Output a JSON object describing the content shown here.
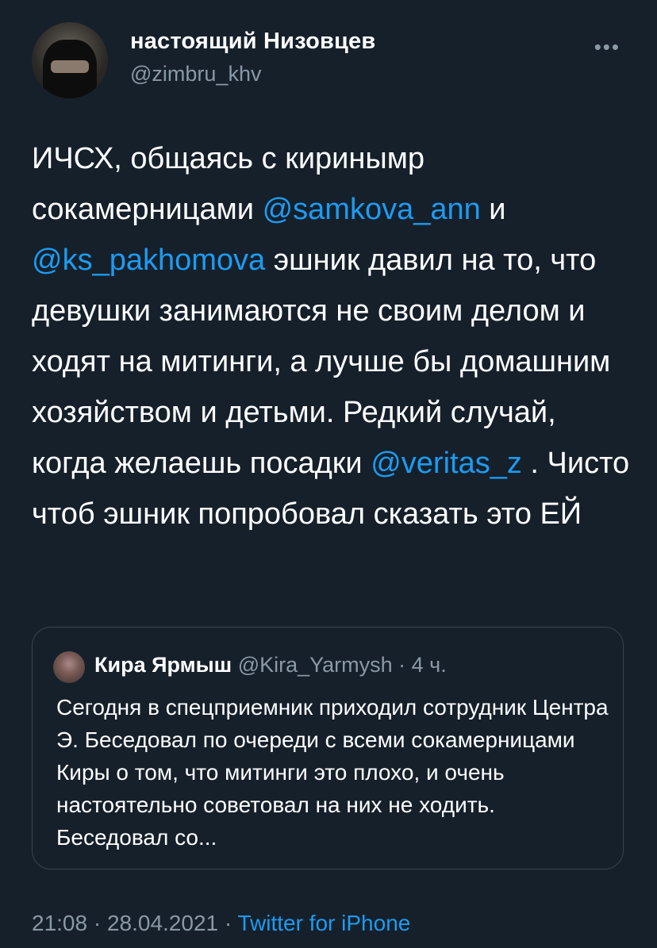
{
  "author": {
    "name": "настоящий Низовцев",
    "handle": "@zimbru_khv",
    "more_icon": "more-dots-icon"
  },
  "tweet": {
    "part1": "ИЧСХ, общаясь с киринымр сокамерницами ",
    "mention1": "@samkova_ann",
    "part2": " и ",
    "mention2": "@ks_pakhomova",
    "part3": " эшник давил на то, что девушки занимаются не своим делом и ходят на митинги, а лучше бы домашним хозяйством и детьми. Редкий случай, когда желаешь посадки ",
    "mention3": "@veritas_z",
    "part4": " . Чисто чтоб эшник попробовал сказать это ЕЙ"
  },
  "quoted": {
    "name": "Кира Ярмыш",
    "handle": "@Kira_Yarmysh",
    "time": "· 4 ч.",
    "text": "Сегодня в спецприемник приходил сотрудник Центра Э.  Беседовал по очереди с всеми сокамерницами Киры о том, что митинги это плохо, и очень настоятельно советовал на них не ходить. Беседовал со..."
  },
  "footer": {
    "datetime": "21:08 · 28.04.2021 · ",
    "source": "Twitter for iPhone"
  },
  "colors": {
    "background": "#15202b",
    "link": "#1d9bf0",
    "secondary": "#8b98a5",
    "border": "#38444d"
  }
}
